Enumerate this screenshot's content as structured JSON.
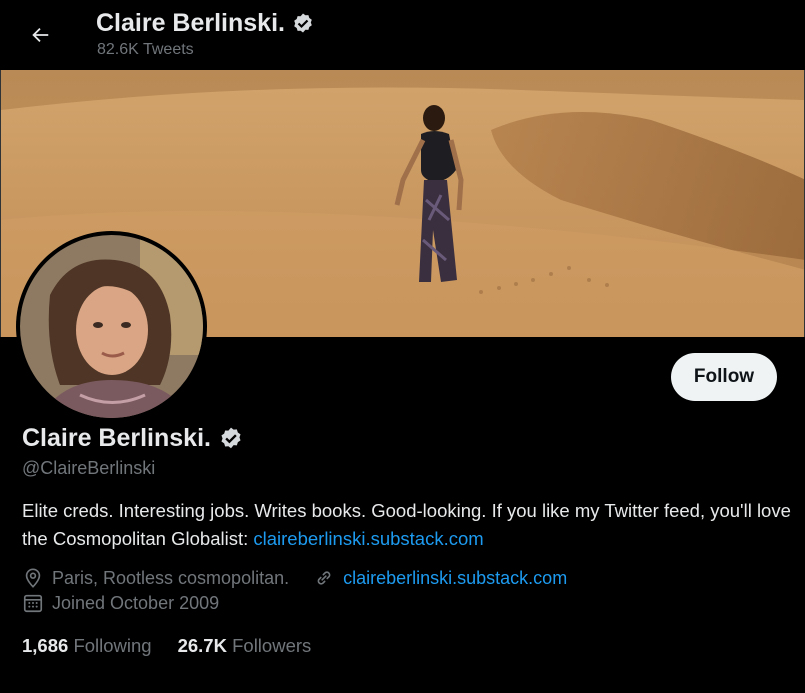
{
  "header": {
    "name": "Claire Berlinski.",
    "tweet_count": "82.6K Tweets"
  },
  "profile": {
    "name": "Claire Berlinski.",
    "handle": "@ClaireBerlinski",
    "follow_label": "Follow",
    "bio_text": "Elite creds. Interesting jobs. Writes books. Good-looking. If you like my Twitter feed, you'll love the Cosmopolitan Globalist: ",
    "bio_link": "claireberlinski.substack.com",
    "location": "Paris, Rootless cosmopolitan.",
    "website": "claireberlinski.substack.com",
    "joined": "Joined October 2009",
    "following_count": "1,686",
    "following_label": "Following",
    "followers_count": "26.7K",
    "followers_label": "Followers"
  },
  "icons": [
    "back-arrow-icon",
    "verified-badge-icon",
    "location-pin-icon",
    "link-icon",
    "calendar-icon"
  ],
  "colors": {
    "background": "#000000",
    "text": "#e7e9ea",
    "muted": "#71767b",
    "link": "#1d9bf0",
    "button": "#eff3f4"
  }
}
